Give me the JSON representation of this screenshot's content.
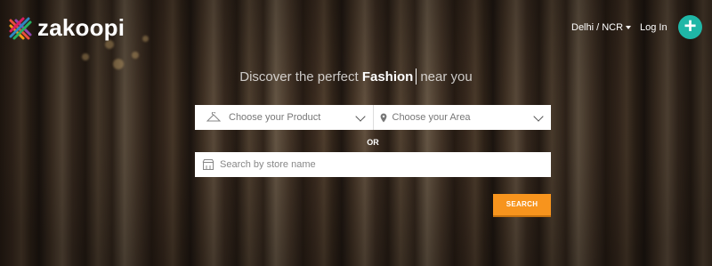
{
  "brand": {
    "name": "zakoopi"
  },
  "nav": {
    "city": "Delhi / NCR",
    "login": "Log In",
    "add": "+"
  },
  "hero": {
    "tagline_before": "Discover the perfect",
    "tagline_category": "Fashion",
    "tagline_after": "near you"
  },
  "search": {
    "product_placeholder": "Choose your Product",
    "area_placeholder": "Choose your Area",
    "or_label": "OR",
    "store_placeholder": "Search by store name",
    "button_label": "SEARCH"
  },
  "colors": {
    "accent_orange": "#f7941d",
    "accent_teal": "#1fb7a7"
  },
  "icons": [
    "hanger-icon",
    "location-pin-icon",
    "store-icon",
    "chevron-down-icon",
    "plus-icon"
  ]
}
